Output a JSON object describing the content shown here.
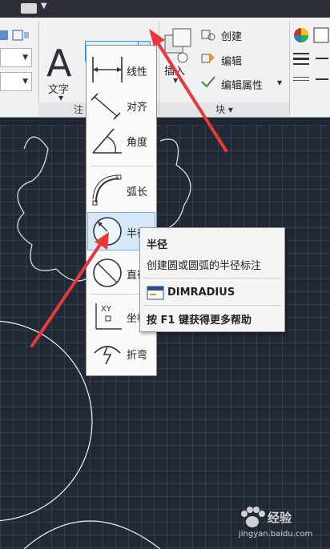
{
  "ribbon": {
    "text_tool_label": "文字",
    "annotation_panel_title": "注",
    "dim_dropdown_label": "线性",
    "insert_label": "插入",
    "create_label": "创建",
    "edit_label": "编辑",
    "edit_attr_label": "编辑属性",
    "block_panel_title": "块 ▾"
  },
  "dim_menu": {
    "items": [
      {
        "label": "线性",
        "icon": "linear-dimension-icon"
      },
      {
        "label": "对齐",
        "icon": "aligned-dimension-icon"
      },
      {
        "label": "角度",
        "icon": "angular-dimension-icon"
      },
      {
        "label": "弧长",
        "icon": "arc-length-icon"
      },
      {
        "label": "半径",
        "icon": "radius-dimension-icon"
      },
      {
        "label": "直径",
        "icon": "diameter-dimension-icon"
      },
      {
        "label": "坐标",
        "icon": "ordinate-dimension-icon"
      },
      {
        "label": "折弯",
        "icon": "jogged-dimension-icon"
      }
    ],
    "highlighted_index": 4
  },
  "tooltip": {
    "title": "半径",
    "description": "创建圆或圆弧的半径标注",
    "command": "DIMRADIUS",
    "help": "按 F1 键获得更多帮助"
  },
  "watermark": {
    "brand": "经验",
    "url": "jingyan.baidu.com"
  },
  "colors": {
    "canvas_bg": "#222936",
    "ribbon_bg": "#f1f1f1",
    "highlight": "#d5e8fa",
    "arrow_red": "#e8393a"
  }
}
